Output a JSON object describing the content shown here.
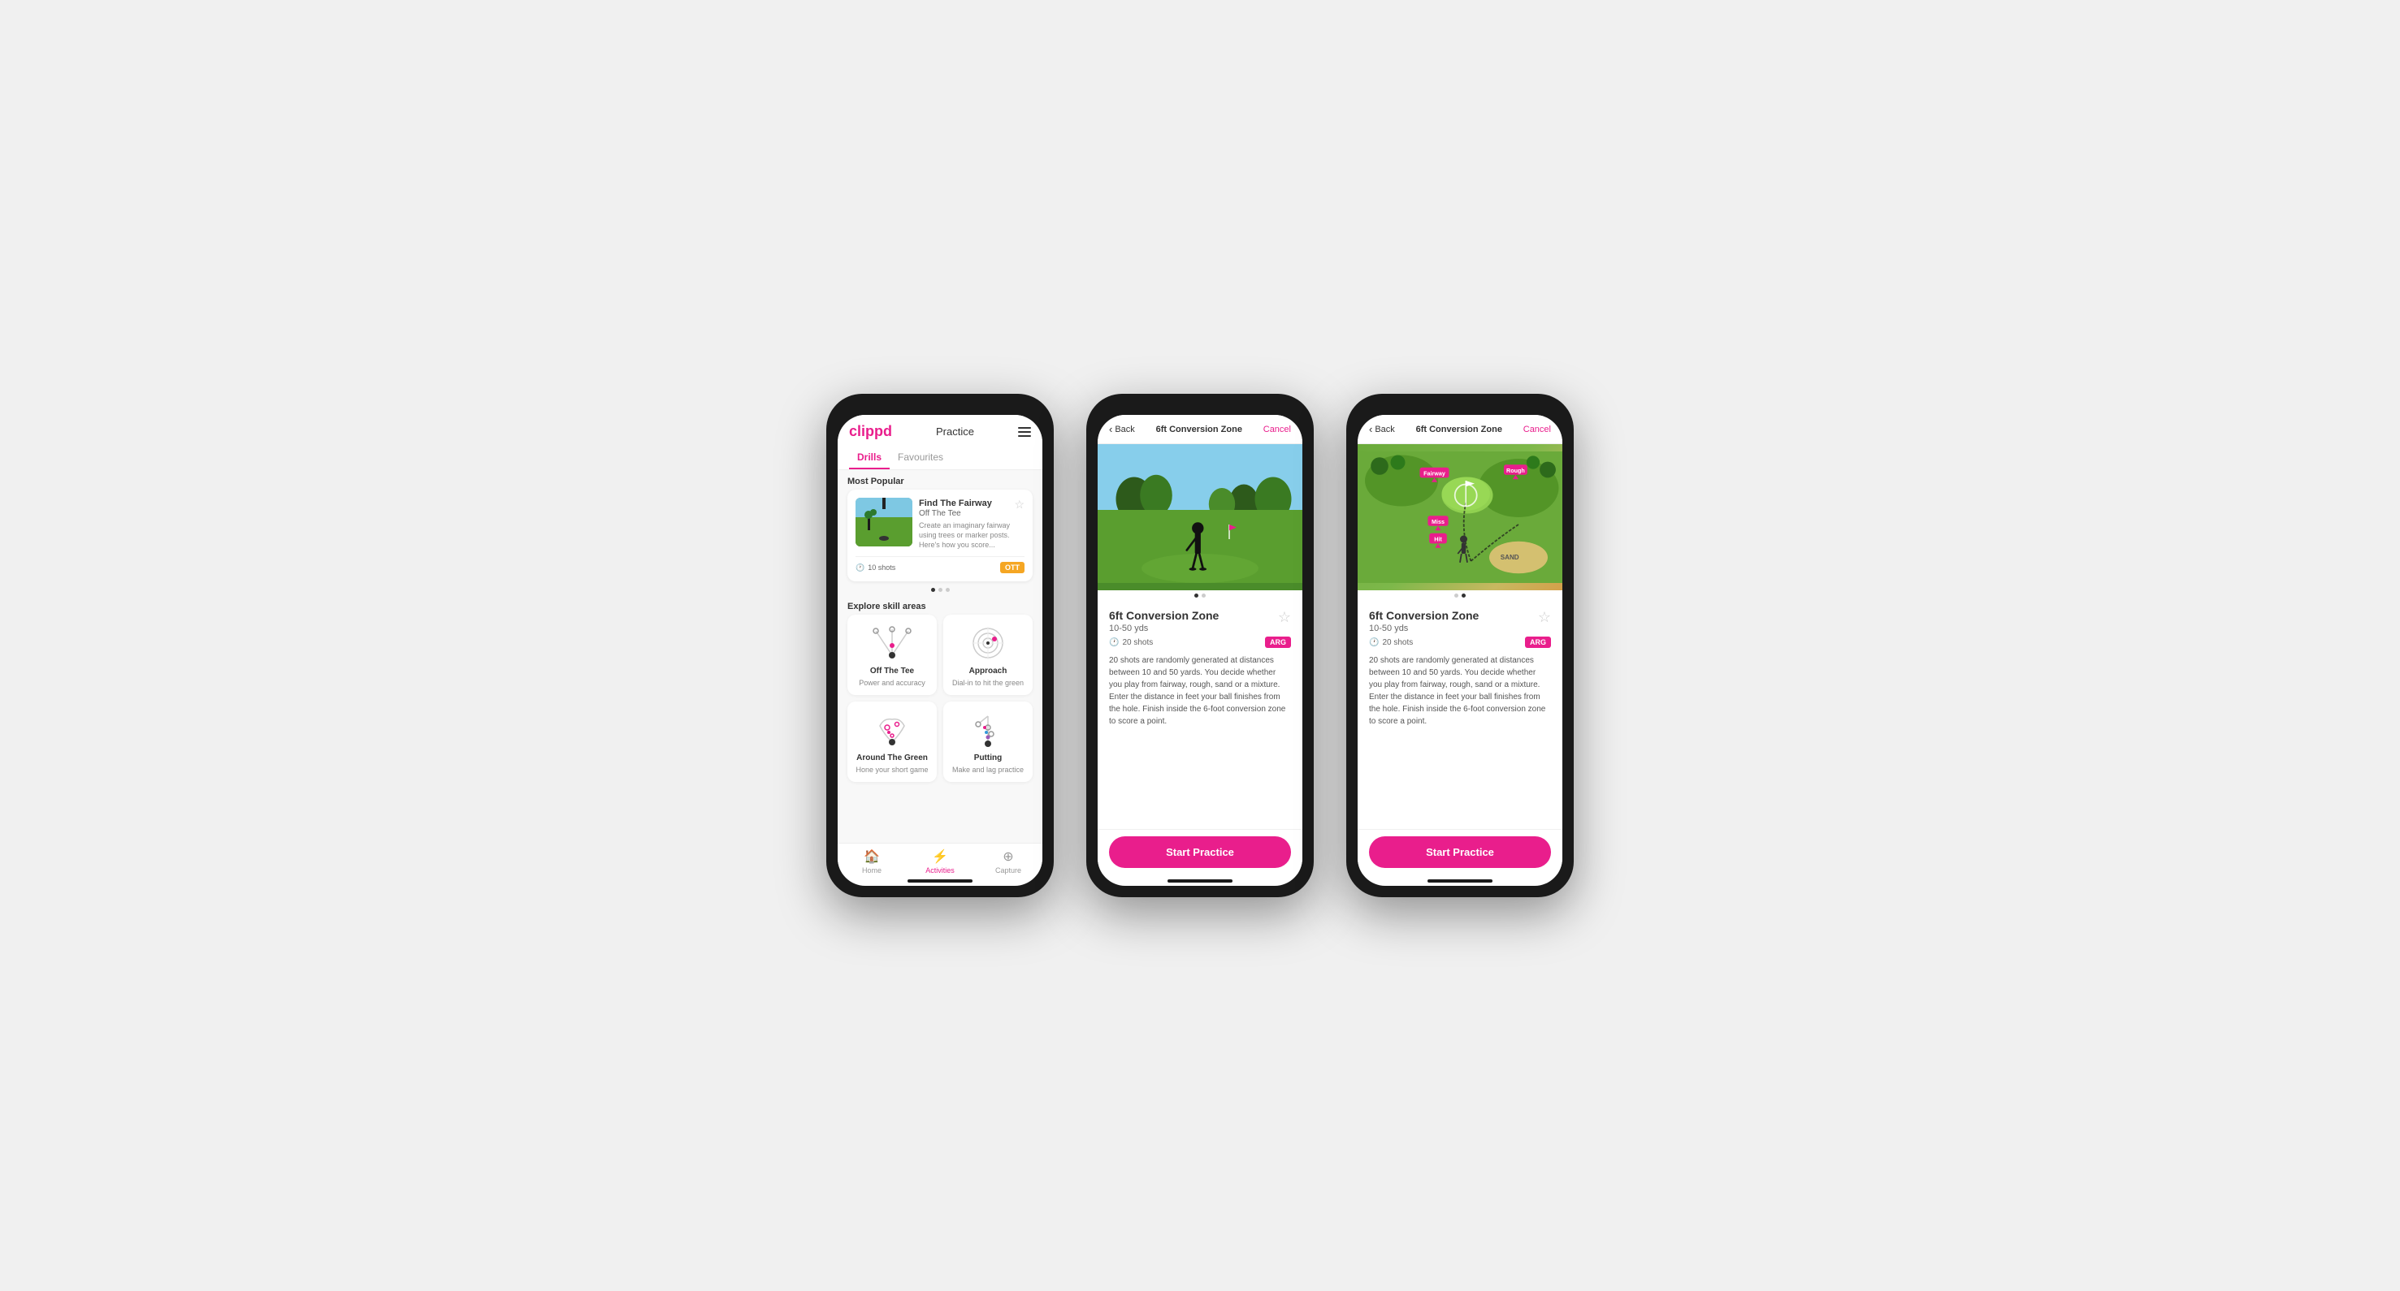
{
  "phones": [
    {
      "id": "phone1",
      "type": "practice-list",
      "header": {
        "logo": "clippd",
        "title": "Practice",
        "menu_icon": "hamburger"
      },
      "tabs": [
        {
          "label": "Drills",
          "active": true
        },
        {
          "label": "Favourites",
          "active": false
        }
      ],
      "most_popular_label": "Most Popular",
      "featured_drill": {
        "title": "Find The Fairway",
        "subtitle": "Off The Tee",
        "description": "Create an imaginary fairway using trees or marker posts. Here's how you score...",
        "shots": "10 shots",
        "tag": "OTT",
        "tag_class": "tag-ott"
      },
      "dots": [
        {
          "active": true
        },
        {
          "active": false
        },
        {
          "active": false
        }
      ],
      "explore_label": "Explore skill areas",
      "skill_areas": [
        {
          "name": "Off The Tee",
          "desc": "Power and accuracy",
          "icon_type": "ott"
        },
        {
          "name": "Approach",
          "desc": "Dial-in to hit the green",
          "icon_type": "approach"
        },
        {
          "name": "Around The Green",
          "desc": "Hone your short game",
          "icon_type": "atg"
        },
        {
          "name": "Putting",
          "desc": "Make and lag practice",
          "icon_type": "putting"
        }
      ],
      "nav": [
        {
          "label": "Home",
          "icon": "🏠",
          "active": false
        },
        {
          "label": "Activities",
          "icon": "⚡",
          "active": true
        },
        {
          "label": "Capture",
          "icon": "⊕",
          "active": false
        }
      ]
    },
    {
      "id": "phone2",
      "type": "detail-photo",
      "header": {
        "back_label": "Back",
        "title": "6ft Conversion Zone",
        "cancel_label": "Cancel"
      },
      "drill": {
        "title": "6ft Conversion Zone",
        "distance": "10-50 yds",
        "shots": "20 shots",
        "tag": "ARG",
        "description": "20 shots are randomly generated at distances between 10 and 50 yards. You decide whether you play from fairway, rough, sand or a mixture. Enter the distance in feet your ball finishes from the hole. Finish inside the 6-foot conversion zone to score a point.",
        "star_icon": "☆"
      },
      "dots": [
        {
          "active": true
        },
        {
          "active": false
        }
      ],
      "start_button": "Start Practice"
    },
    {
      "id": "phone3",
      "type": "detail-map",
      "header": {
        "back_label": "Back",
        "title": "6ft Conversion Zone",
        "cancel_label": "Cancel"
      },
      "drill": {
        "title": "6ft Conversion Zone",
        "distance": "10-50 yds",
        "shots": "20 shots",
        "tag": "ARG",
        "description": "20 shots are randomly generated at distances between 10 and 50 yards. You decide whether you play from fairway, rough, sand or a mixture. Enter the distance in feet your ball finishes from the hole. Finish inside the 6-foot conversion zone to score a point.",
        "star_icon": "☆",
        "map_labels": [
          "Fairway",
          "Rough",
          "Miss",
          "Hit",
          "Sand"
        ]
      },
      "dots": [
        {
          "active": false
        },
        {
          "active": true
        }
      ],
      "start_button": "Start Practice"
    }
  ]
}
